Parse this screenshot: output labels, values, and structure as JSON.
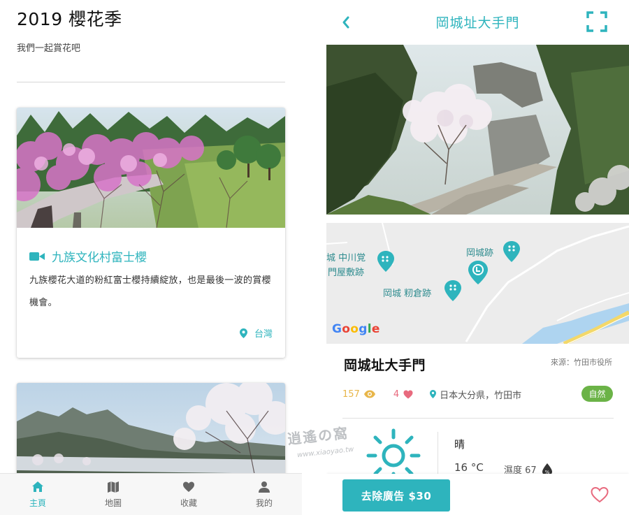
{
  "home": {
    "title": "2019 櫻花季",
    "subtitle": "我們一起賞花吧",
    "cards": [
      {
        "title": "九族文化村富士櫻",
        "description": "九族櫻花大道的粉紅富士櫻持續綻放，也是最後一波的賞櫻機會。",
        "location": "台灣"
      }
    ],
    "nav": [
      {
        "label": "主頁",
        "icon": "home-icon",
        "active": true
      },
      {
        "label": "地圖",
        "icon": "map-icon",
        "active": false
      },
      {
        "label": "收藏",
        "icon": "heart-icon",
        "active": false
      },
      {
        "label": "我的",
        "icon": "user-icon",
        "active": false
      }
    ]
  },
  "detail": {
    "header_title": "岡城址大手門",
    "place_name": "岡城址大手門",
    "source": "來源：竹田市役所",
    "views": "157",
    "likes": "4",
    "location": "日本大分県，竹田市",
    "tag": "自然",
    "map": {
      "labels": [
        "城 中川覚",
        "門屋敷跡",
        "岡城跡",
        "岡城 籾倉跡"
      ],
      "provider": "Google"
    },
    "weather": {
      "condition": "晴",
      "temperature": "16 °C",
      "humidity": "濕度 67"
    },
    "remove_ads_label": "去除廣告 $30"
  },
  "watermark": {
    "text": "逍遙の窩",
    "url": "www.xiaoyao.tw"
  },
  "colors": {
    "accent": "#2eb4bd",
    "views": "#e8b64a",
    "likes": "#e86a7e",
    "tag": "#6bb347"
  }
}
